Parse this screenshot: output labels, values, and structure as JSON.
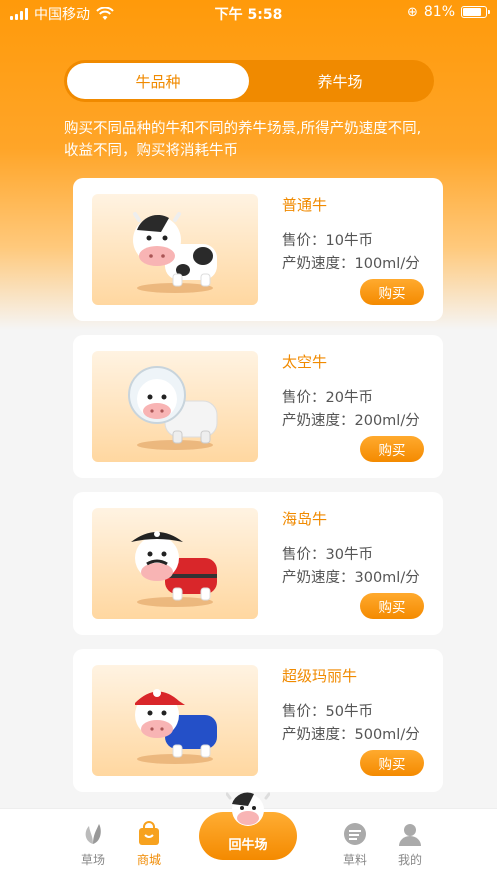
{
  "status_bar": {
    "carrier": "中国移动",
    "time": "下午 5:58",
    "battery": "81%"
  },
  "tabs": [
    {
      "label": "牛品种",
      "active": true
    },
    {
      "label": "养牛场",
      "active": false
    }
  ],
  "description": "购买不同品种的牛和不同的养牛场景,所得产奶速度不同,收益不同，购买将消耗牛币",
  "cards": [
    {
      "name": "普通牛",
      "price": "售价：10牛币",
      "speed": "产奶速度：100ml/分",
      "buy_label": "购买",
      "icon": "plain-cow-icon"
    },
    {
      "name": "太空牛",
      "price": "售价：20牛币",
      "speed": "产奶速度：200ml/分",
      "buy_label": "购买",
      "icon": "space-cow-icon"
    },
    {
      "name": "海岛牛",
      "price": "售价：30牛币",
      "speed": "产奶速度：300ml/分",
      "buy_label": "购买",
      "icon": "pirate-cow-icon"
    },
    {
      "name": "超级玛丽牛",
      "price": "售价：50牛币",
      "speed": "产奶速度：500ml/分",
      "buy_label": "购买",
      "icon": "mario-cow-icon"
    }
  ],
  "bottom_nav": {
    "grassland": "草场",
    "shop": "商城",
    "center": "回牛场",
    "feed": "草料",
    "mine": "我的"
  },
  "colors": {
    "accent": "#f08a00",
    "header_gradient_top": "#ff9a0a"
  }
}
